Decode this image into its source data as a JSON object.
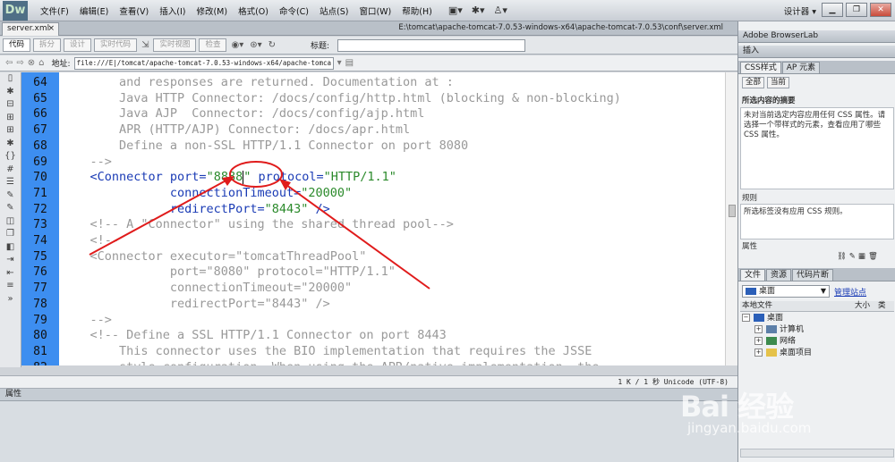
{
  "app": {
    "logo": "Dw",
    "menu": [
      "文件(F)",
      "编辑(E)",
      "查看(V)",
      "插入(I)",
      "修改(M)",
      "格式(O)",
      "命令(C)",
      "站点(S)",
      "窗口(W)",
      "帮助(H)"
    ],
    "workspace": "设计器 ▾"
  },
  "document": {
    "tab": "server.xml",
    "path": "E:\\tomcat\\apache-tomcat-7.0.53-windows-x64\\apache-tomcat-7.0.53\\conf\\server.xml"
  },
  "toolbar": {
    "buttons": [
      "代码",
      "拆分",
      "设计",
      "实时代码",
      "实时视图",
      "检查"
    ],
    "title_label": "标题:",
    "title_value": ""
  },
  "address": {
    "label": "地址:",
    "value": "file:///E|/tomcat/apache-tomcat-7.0.53-windows-x64/apache-tomca"
  },
  "code": {
    "lines": [
      {
        "n": "64",
        "text": "        and responses are returned. Documentation at :",
        "kind": "comment"
      },
      {
        "n": "65",
        "text": "        Java HTTP Connector: /docs/config/http.html (blocking & non-blocking)",
        "kind": "comment"
      },
      {
        "n": "66",
        "text": "        Java AJP  Connector: /docs/config/ajp.html",
        "kind": "comment"
      },
      {
        "n": "67",
        "text": "        APR (HTTP/AJP) Connector: /docs/apr.html",
        "kind": "comment"
      },
      {
        "n": "68",
        "text": "        Define a non-SSL HTTP/1.1 Connector on port 8080",
        "kind": "comment"
      },
      {
        "n": "69",
        "text": "    -->",
        "kind": "comment"
      },
      {
        "n": "70",
        "text": "    <Connector port=\"8888\" protocol=\"HTTP/1.1\"",
        "kind": "tag"
      },
      {
        "n": "71",
        "text": "               connectionTimeout=\"20000\"",
        "kind": "tag"
      },
      {
        "n": "72",
        "text": "               redirectPort=\"8443\" />",
        "kind": "tag"
      },
      {
        "n": "73",
        "text": "    <!-- A \"Connector\" using the shared thread pool-->",
        "kind": "comment"
      },
      {
        "n": "74",
        "text": "    <!--",
        "kind": "comment"
      },
      {
        "n": "75",
        "text": "    <Connector executor=\"tomcatThreadPool\"",
        "kind": "comment"
      },
      {
        "n": "76",
        "text": "               port=\"8080\" protocol=\"HTTP/1.1\"",
        "kind": "comment"
      },
      {
        "n": "77",
        "text": "               connectionTimeout=\"20000\"",
        "kind": "comment"
      },
      {
        "n": "78",
        "text": "               redirectPort=\"8443\" />",
        "kind": "comment"
      },
      {
        "n": "79",
        "text": "    -->",
        "kind": "comment"
      },
      {
        "n": "80",
        "text": "    <!-- Define a SSL HTTP/1.1 Connector on port 8443",
        "kind": "comment"
      },
      {
        "n": "81",
        "text": "        This connector uses the BIO implementation that requires the JSSE",
        "kind": "comment"
      },
      {
        "n": "82",
        "text": "        style configuration. When using the APR/native implementation, the",
        "kind": "comment"
      }
    ]
  },
  "status": {
    "info": "1 K / 1 秒  Unicode (UTF-8)",
    "properties_label": "属性"
  },
  "right_panel": {
    "browserlab": "Adobe BrowserLab",
    "insert": "插入",
    "tabs_css": [
      "CSS样式",
      "AP 元素"
    ],
    "buttons": [
      "全部",
      "当前"
    ],
    "section_summary": "所选内容的摘要",
    "summary_text": "未对当前选定内容应用任何 CSS 属性。请选择一个带样式的元素，查看应用了哪些 CSS 属性。",
    "rules_label": "规则",
    "rules_text": "所选标签没有应用 CSS 规则。",
    "properties_label": "属性",
    "files_tabs": [
      "文件",
      "资源",
      "代码片断"
    ],
    "location": "桌面",
    "manage_sites": "管理站点",
    "col_local": "本地文件",
    "col_size": "大小",
    "col_type": "类",
    "tree": [
      {
        "label": "桌面",
        "level": 0,
        "toggle": "−"
      },
      {
        "label": "计算机",
        "level": 1,
        "toggle": "+"
      },
      {
        "label": "网络",
        "level": 1,
        "toggle": "+"
      },
      {
        "label": "桌面项目",
        "level": 1,
        "toggle": "+"
      }
    ]
  },
  "watermark": {
    "text": "Bai 经验",
    "url": "jingyan.baidu.com"
  },
  "colors": {
    "gutter": "#3d8ef0",
    "annotation": "#e01b1b"
  }
}
